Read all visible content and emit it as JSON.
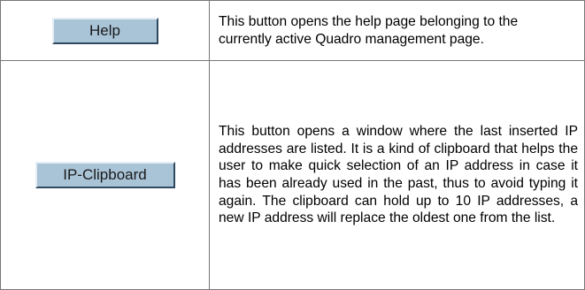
{
  "rows": [
    {
      "button_label": "Help",
      "description": "This button opens the help page belonging to the currently active Quadro management page."
    },
    {
      "button_label": "IP-Clipboard",
      "description": "This button opens a window where the last inserted IP addresses are listed. It is a kind of clipboard that helps the user to make quick selection of an IP address in case it has been already used in the past, thus to avoid typing it again. The clipboard can hold up to 10 IP addresses, a new IP address will replace the oldest one from the list."
    }
  ],
  "colors": {
    "button_face": "#a9c3d7",
    "border": "#777777"
  }
}
